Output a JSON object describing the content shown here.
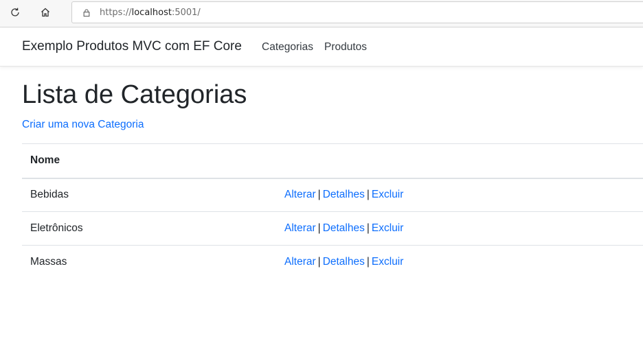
{
  "browser": {
    "url_scheme": "https://",
    "url_host": "localhost",
    "url_rest": ":5001/"
  },
  "navbar": {
    "brand": "Exemplo Produtos MVC com EF Core",
    "links": [
      "Categorias",
      "Produtos"
    ]
  },
  "main": {
    "title": "Lista de Categorias",
    "create_link": "Criar uma nova Categoria",
    "table": {
      "headers": [
        "Nome",
        ""
      ],
      "rows": [
        {
          "nome": "Bebidas"
        },
        {
          "nome": "Eletrônicos"
        },
        {
          "nome": "Massas"
        }
      ],
      "actions": {
        "edit": "Alterar",
        "details": "Detalhes",
        "delete": "Excluir",
        "separator": "|"
      }
    }
  },
  "colors": {
    "link": "#0d6efd",
    "text": "#212529",
    "border": "#dee2e6"
  }
}
